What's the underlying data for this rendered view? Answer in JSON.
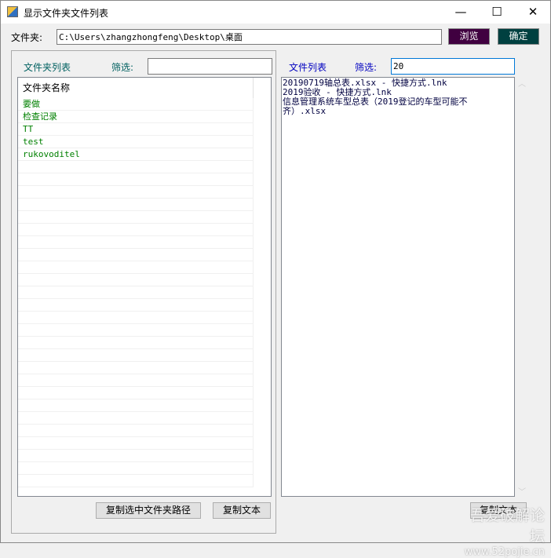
{
  "window": {
    "title": "显示文件夹文件列表",
    "minimize": "—",
    "maximize": "☐",
    "close": "✕"
  },
  "folder": {
    "label": "文件夹:",
    "path": "C:\\Users\\zhangzhongfeng\\Desktop\\桌面",
    "browse": "浏览",
    "ok": "确定",
    "browse_color": "#400040",
    "ok_color": "#004040"
  },
  "left": {
    "title": "文件夹列表",
    "filter_label": "筛选:",
    "filter_value": "",
    "column": "文件夹名称",
    "items": [
      "要做",
      "检查记录",
      "TT",
      "test",
      "rukovoditel"
    ],
    "copy_path": "复制选中文件夹路径",
    "copy_text": "复制文本"
  },
  "right": {
    "title": "文件列表",
    "filter_label": "筛选:",
    "filter_value": "20",
    "text": "20190719轴总表.xlsx - 快捷方式.lnk\n2019验收 - 快捷方式.lnk\n信息管理系统车型总表（2019登记的车型可能不\n齐）.xlsx",
    "copy_text": "复制文本"
  },
  "watermark": {
    "line1": "吾爱破解论坛",
    "line2": "www.52pojie.cn"
  }
}
